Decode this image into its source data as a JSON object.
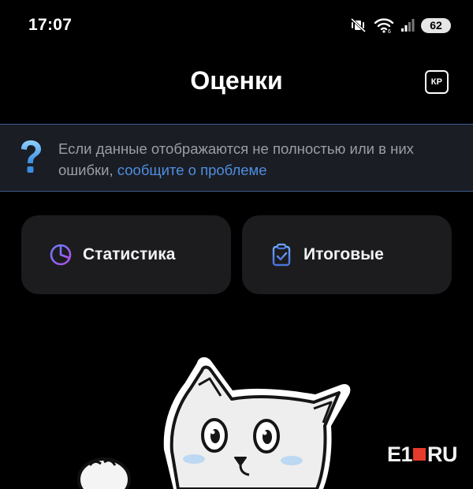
{
  "status_bar": {
    "time": "17:07",
    "battery": "62",
    "icons": [
      "muted-vibrate-icon",
      "wifi-icon",
      "signal-icon",
      "battery-icon"
    ]
  },
  "header": {
    "title": "Оценки",
    "kp_label": "КР"
  },
  "banner": {
    "icon": "question-icon",
    "text": "Если данные отображаются не полностью или в них ошибки, ",
    "link": "сообщите о проблеме"
  },
  "cards": [
    {
      "label": "Статистика",
      "icon": "pie-chart-icon"
    },
    {
      "label": "Итоговые",
      "icon": "clipboard-check-icon"
    }
  ],
  "watermark": {
    "part1": "E1",
    "part2": "RU"
  },
  "colors": {
    "background": "#000000",
    "banner_bg": "#1a1d24",
    "banner_border": "#3d5b8c",
    "link": "#4f8ee0",
    "card_bg": "#1c1c1f",
    "accent_purple": "#8a5cf6",
    "accent_blue": "#5b8fe6",
    "watermark_red": "#e63a2c"
  }
}
